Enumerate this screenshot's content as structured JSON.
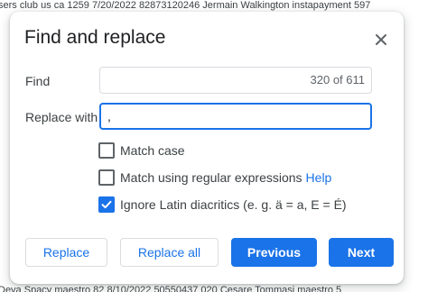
{
  "background": {
    "top_text": "sers club us ca 1259 7/20/2022 82873120246 Jermain Walkington instapayment 597",
    "bottom_text": "Deva Spacy maestro 82 8/10/2022 50550437 020 Cesare Tommasi maestro 5"
  },
  "dialog": {
    "title": "Find and replace",
    "find": {
      "label": "Find",
      "value": "",
      "match_count": "320 of 611"
    },
    "replace": {
      "label": "Replace with",
      "value": ","
    },
    "options": [
      {
        "label": "Match case",
        "checked": false
      },
      {
        "label": "Match using regular expressions",
        "checked": false,
        "help_link": "Help"
      },
      {
        "label": "Ignore Latin diacritics (e. g. ä = a, E = É)",
        "checked": true
      }
    ],
    "buttons": {
      "replace": "Replace",
      "replace_all": "Replace all",
      "previous": "Previous",
      "next": "Next"
    }
  },
  "colors": {
    "accent": "#1a73e8",
    "cell_highlight": "#b7e1a1"
  },
  "icons": {
    "close": "close-icon",
    "checkmark": "checkmark-icon"
  }
}
